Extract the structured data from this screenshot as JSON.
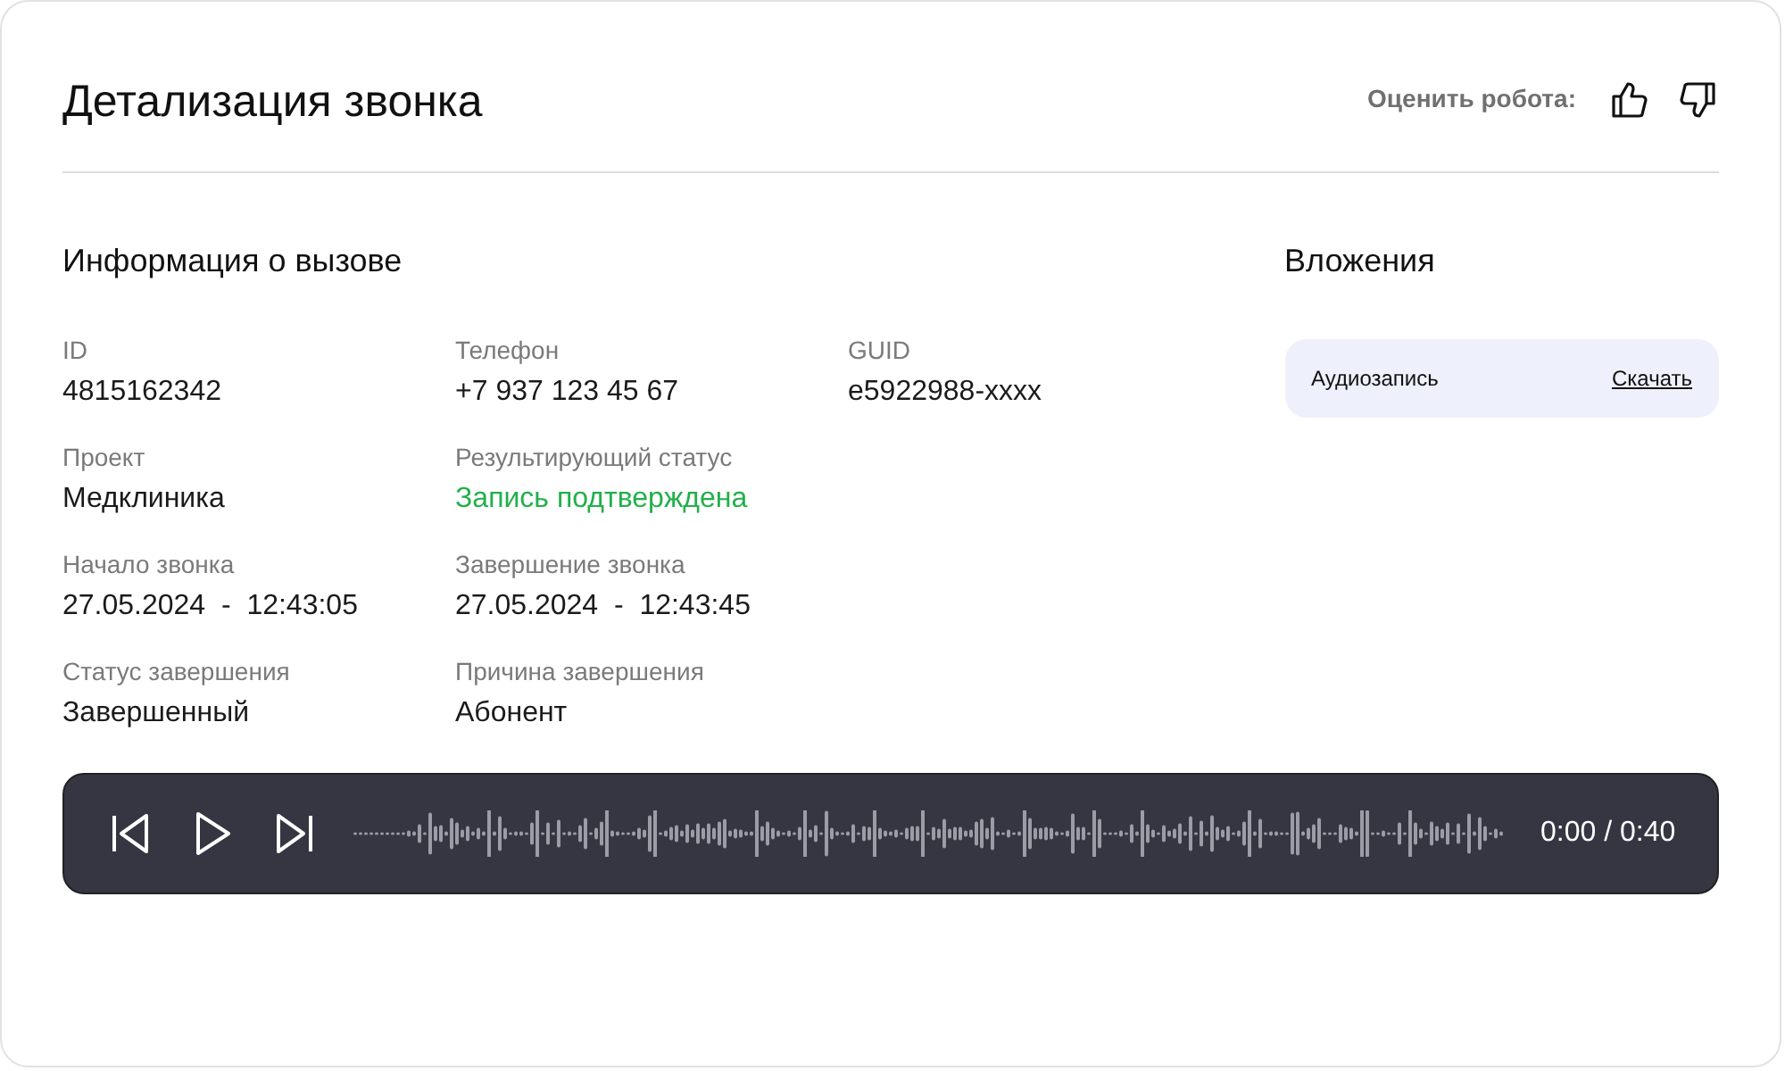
{
  "header": {
    "title": "Детализация звонка",
    "rate_label": "Оценить робота:"
  },
  "call_info": {
    "title": "Информация о вызове",
    "fields": [
      {
        "label": "ID",
        "value": "4815162342",
        "kind": "plain"
      },
      {
        "label": "Телефон",
        "value": "+7 937 123 45 67",
        "kind": "plain"
      },
      {
        "label": "GUID",
        "value": "e5922988-xxxx",
        "kind": "plain"
      },
      {
        "label": "Проект",
        "value": "Медклиника",
        "kind": "plain"
      },
      {
        "label": "Результирующий статус",
        "value": "Запись подтверждена",
        "kind": "success"
      },
      {
        "label": "Начало звонка",
        "value": "27.05.2024  -  12:43:05",
        "kind": "plain"
      },
      {
        "label": "Завершение звонка",
        "value": "27.05.2024  -  12:43:45",
        "kind": "plain"
      },
      {
        "label": "Статус завершения",
        "value": "Завершенный",
        "kind": "plain"
      },
      {
        "label": "Причина завершения",
        "value": "Абонент",
        "kind": "plain"
      }
    ]
  },
  "attachments": {
    "title": "Вложения",
    "items": [
      {
        "name": "Аудиозапись",
        "action": "Скачать"
      }
    ]
  },
  "player": {
    "time": "0:00 / 0:40"
  }
}
